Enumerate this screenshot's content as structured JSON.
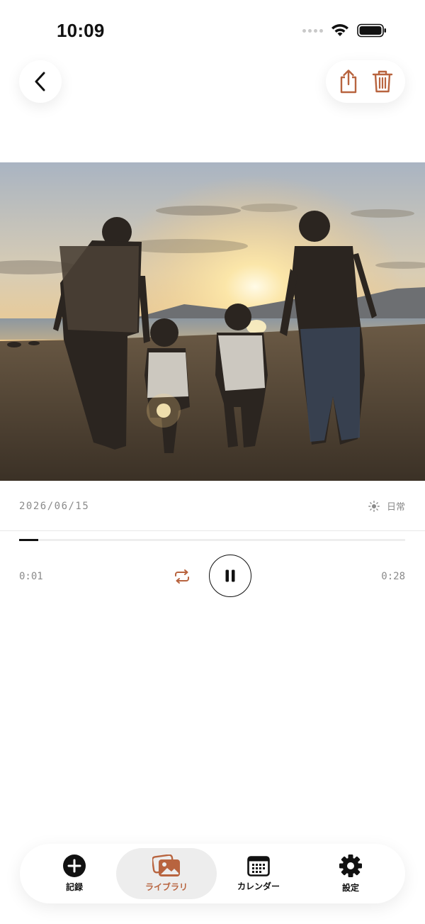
{
  "status_bar": {
    "time": "10:09"
  },
  "entry": {
    "date": "2026/06/15",
    "category": {
      "label": "日常",
      "icon": "sun-icon"
    }
  },
  "player": {
    "current_time": "0:01",
    "total_time": "0:28",
    "progress": 0.05,
    "state": "playing"
  },
  "tabs": [
    {
      "label": "記録",
      "icon": "add-circle-icon",
      "active": false
    },
    {
      "label": "ライブラリ",
      "icon": "photo-library-icon",
      "active": true
    },
    {
      "label": "カレンダー",
      "icon": "calendar-icon",
      "active": false
    },
    {
      "label": "設定",
      "icon": "gear-icon",
      "active": false
    }
  ],
  "colors": {
    "accent": "#b8643f",
    "text_muted": "#8a8a8a",
    "tab_active_bg": "#ededed"
  }
}
